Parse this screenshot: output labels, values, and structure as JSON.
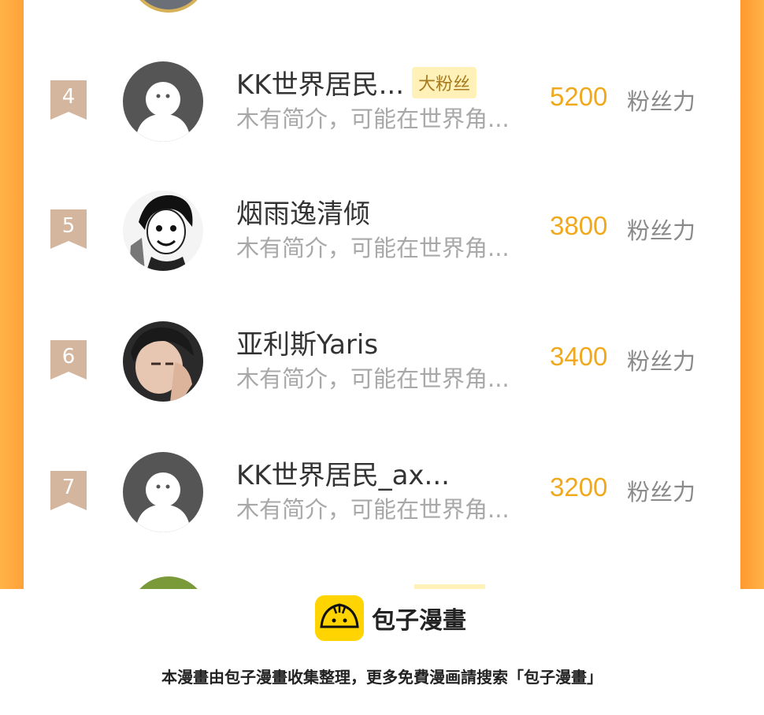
{
  "users": [
    {
      "rank": "4",
      "name": "KK世界居民...",
      "badge": "大粉丝",
      "bio": "木有简介，可能在世界角...",
      "score": "5200",
      "unit": "粉丝力",
      "avatar": "default-avatar-icon"
    },
    {
      "rank": "5",
      "name": "烟雨逸清倾",
      "badge": "",
      "bio": "木有简介，可能在世界角...",
      "score": "3800",
      "unit": "粉丝力",
      "avatar": "manga-avatar"
    },
    {
      "rank": "6",
      "name": "亚利斯Yaris",
      "badge": "",
      "bio": "木有简介，可能在世界角...",
      "score": "3400",
      "unit": "粉丝力",
      "avatar": "photo-avatar"
    },
    {
      "rank": "7",
      "name": "KK世界居民_ax...",
      "badge": "",
      "bio": "木有简介，可能在世界角...",
      "score": "3200",
      "unit": "粉丝力",
      "avatar": "default-avatar-icon"
    }
  ],
  "footer": {
    "brand": "包子漫畫",
    "note": "本漫畫由包子漫畫收集整理，更多免費漫画請搜索「包子漫畫」"
  },
  "colors": {
    "frame": "#ff9a30",
    "score": "#f0a81c",
    "rank_ribbon": "#d4b59e",
    "badge_bg": "#fff1b8",
    "logo_yellow": "#ffd400"
  }
}
